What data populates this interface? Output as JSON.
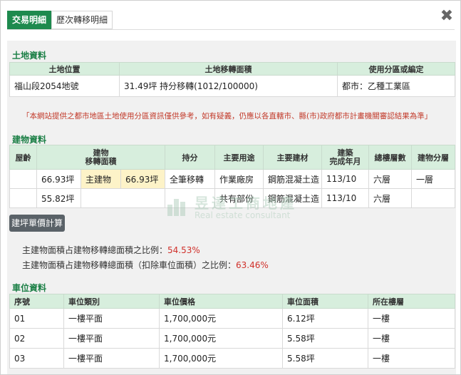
{
  "tabs": [
    "交易明細",
    "歷次轉移明細"
  ],
  "close_glyph": "✖",
  "land": {
    "title": "土地資料",
    "headers": [
      "土地位置",
      "土地移轉面積",
      "使用分區或編定"
    ],
    "row": [
      "福山段2054地號",
      "31.49坪 持分移轉(1012/100000)",
      "都市：乙種工業區"
    ]
  },
  "notice": "「本網站提供之都市地區土地使用分區資訊僅供參考，如有疑義，仍應以各直轄市、縣(市)政府都市計畫機關審認結果為準」",
  "building": {
    "title": "建物資料",
    "headers": {
      "age": "屋齡",
      "area": "建物\n移轉面積",
      "share": "持分",
      "use": "主要用途",
      "material": "主要建材",
      "completed": "建築\n完成年月",
      "floors": "總樓層數",
      "division": "建物分層"
    },
    "rows": [
      {
        "age": "",
        "area": "66.93坪",
        "tag": "主建物",
        "tag_area": "66.93坪",
        "share": "全筆移轉",
        "use": "作業廠房",
        "material": "鋼筋混凝土造",
        "completed": "113/10",
        "floors": "六層",
        "division": "一層"
      },
      {
        "age": "",
        "area": "55.82坪",
        "tag": "",
        "tag_area": "",
        "share": "",
        "use": "共有部份",
        "material": "鋼筋混凝土造",
        "completed": "113/10",
        "floors": "六層",
        "division": ""
      }
    ]
  },
  "watermark": {
    "zh": "昱達工商地產",
    "en": "Real estate consultant"
  },
  "calc_button": "建坪單價計算",
  "ratios": [
    {
      "label": "主建物面積占建物移轉總面積之比例：",
      "value": "54.53%"
    },
    {
      "label": "主建物面積占建物移轉總面積（扣除車位面積）之比例：",
      "value": "63.46%"
    }
  ],
  "parking": {
    "title": "車位資料",
    "headers": [
      "序號",
      "車位類別",
      "車位價格",
      "車位面積",
      "所在樓層"
    ],
    "rows": [
      [
        "01",
        "一樓平面",
        "1,700,000元",
        "6.12坪",
        "一樓"
      ],
      [
        "02",
        "一樓平面",
        "1,700,000元",
        "5.58坪",
        "一樓"
      ],
      [
        "03",
        "一樓平面",
        "1,700,000元",
        "5.58坪",
        "一樓"
      ]
    ]
  },
  "colors": {
    "accent": "#1e8a4e",
    "header_bg": "#d7eedd",
    "highlight": "#fdf3c8",
    "value_red": "#d0302a",
    "notice_red": "#c23a2a"
  }
}
